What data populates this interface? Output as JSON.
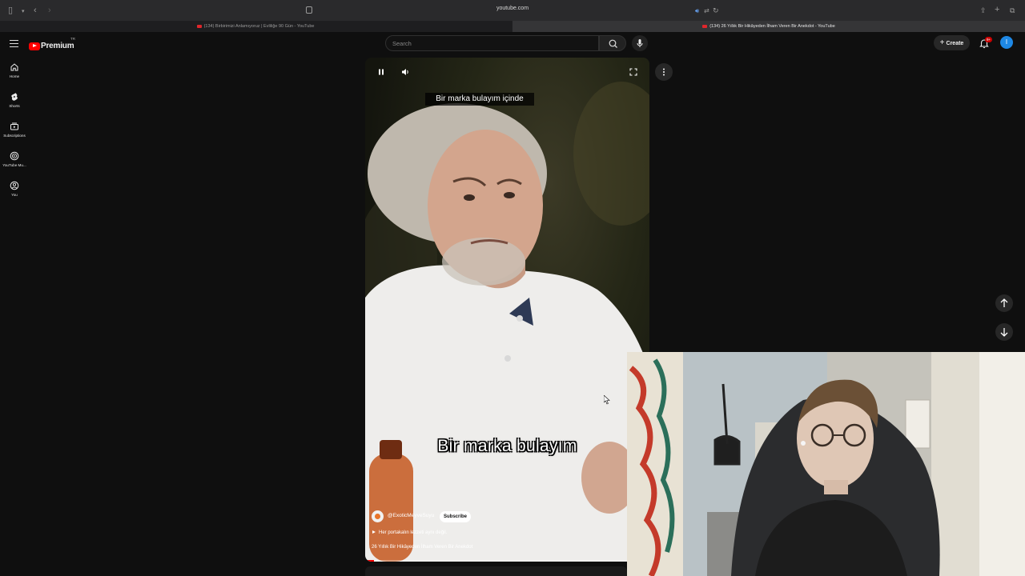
{
  "browser": {
    "url": "youtube.com",
    "tabs": [
      {
        "title": "(134) Birbirimizi Anlamıyoruz | Evliliğe 90 Gün - YouTube",
        "active": false
      },
      {
        "title": "(134) 26 Yıllık Bir Hikâyeden İlham Veren Bir Anekdot - YouTube",
        "active": true
      }
    ]
  },
  "header": {
    "brand": "Premium",
    "region": "TR",
    "search_placeholder": "Search",
    "create_label": "Create",
    "notifications_badge": "9+",
    "avatar_initial": "I"
  },
  "guide": {
    "items": [
      {
        "label": "Home",
        "icon": "home-icon"
      },
      {
        "label": "Shorts",
        "icon": "shorts-icon"
      },
      {
        "label": "Subscriptions",
        "icon": "subscriptions-icon"
      },
      {
        "label": "YouTube Mu...",
        "icon": "youtube-music-icon"
      },
      {
        "label": "You",
        "icon": "you-icon"
      }
    ]
  },
  "short": {
    "caption_top": "Bir marka bulayım içinde",
    "caption_main": "Bir marka bulayım",
    "channel": "@ExoticMeyveSuyu",
    "subscribe_label": "Subscribe",
    "song": "Her portakalın lezzeti aynı değil.",
    "title": "26 Yıllık Bir Hikâyeden İlham Veren Bir Anekdot",
    "progress": 0.03
  },
  "colors": {
    "accent": "#ff0000",
    "background": "#0f0f0f",
    "avatar": "#1e88e5"
  }
}
